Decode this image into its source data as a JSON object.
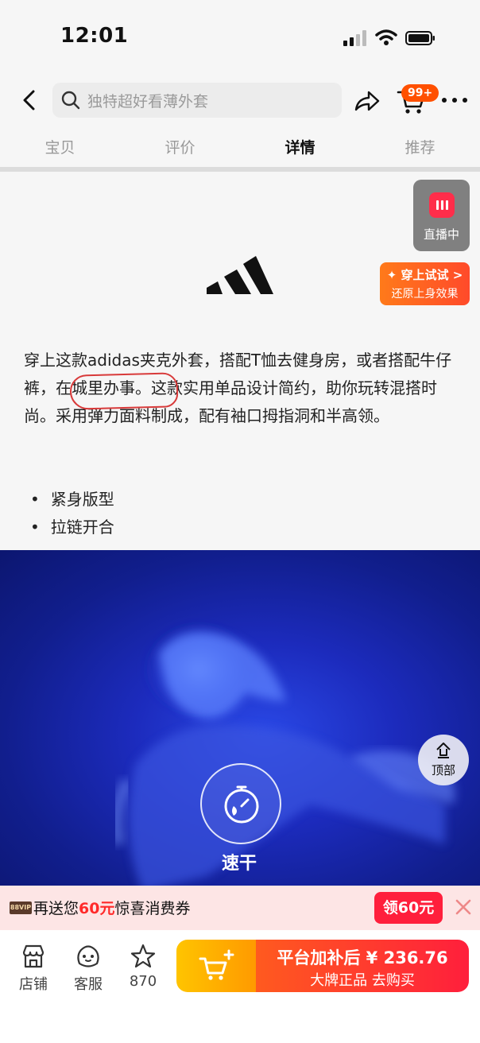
{
  "status_bar": {
    "time": "12:01"
  },
  "header": {
    "search_placeholder": "独特超好看薄外套",
    "cart_badge": "99+"
  },
  "tabs": [
    {
      "label": "宝贝",
      "active": false
    },
    {
      "label": "评价",
      "active": false
    },
    {
      "label": "详情",
      "active": true
    },
    {
      "label": "推荐",
      "active": false
    }
  ],
  "live": {
    "label": "直播中"
  },
  "tryon": {
    "title": "✦ 穿上试试 >",
    "subtitle": "还原上身效果"
  },
  "description": {
    "part1": "穿上这款adidas夹克外套，搭配T恤去健身房，或者搭配牛仔裤，",
    "highlight": "在城里办事。",
    "part2": "这款实用单品设计简约，助你玩转混搭时尚。采用弹力面料制成，配有袖口拇指洞和半高领。"
  },
  "features": [
    "紧身版型",
    "拉链开合"
  ],
  "hero": {
    "feature_label": "速干"
  },
  "top_button": {
    "label": "顶部"
  },
  "coupon": {
    "vip": "88VIP",
    "prefix": "再送您",
    "amount": "60元",
    "suffix": "惊喜消费券",
    "claim_label": "领60元"
  },
  "bottom_bar": {
    "store_label": "店铺",
    "service_label": "客服",
    "favorites_count": "870",
    "buy_price_line": "平台加补后 ¥ 236.76",
    "buy_subtitle": "大牌正品 去购买"
  },
  "colors": {
    "accent_orange": "#ff5000",
    "accent_red": "#ff1f3c",
    "hero_blue": "#1c2bbd"
  }
}
